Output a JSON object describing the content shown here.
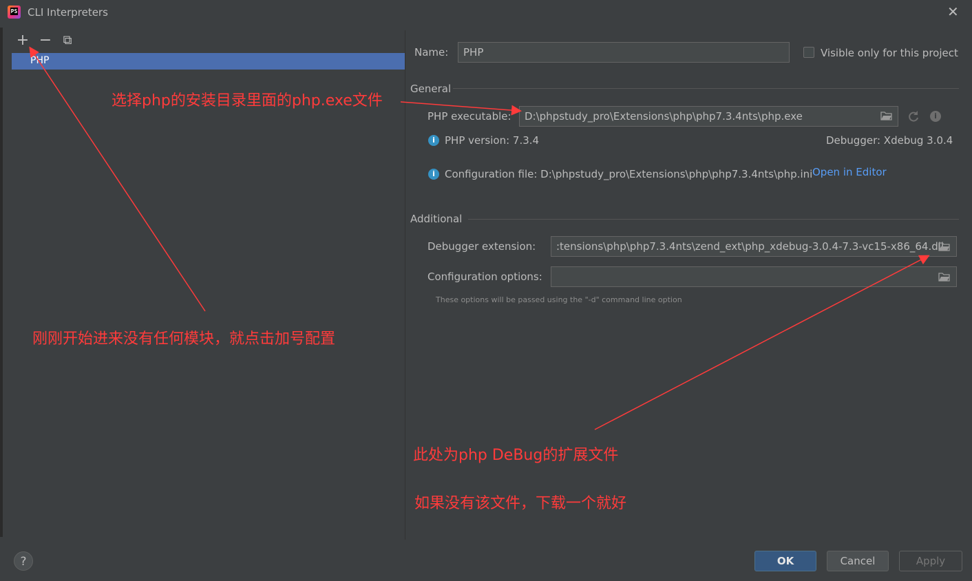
{
  "window": {
    "title": "CLI Interpreters",
    "close_glyph": "✕",
    "icon": "phpstorm-logo",
    "icon_text": "PS"
  },
  "toolbar": {
    "add_glyph": "+",
    "remove_glyph": "−",
    "copy_glyph": "⧉"
  },
  "interpreter_list": {
    "items": [
      {
        "label": "PHP",
        "selected": true
      }
    ]
  },
  "form": {
    "name_label": "Name:",
    "name_value": "PHP",
    "visible_only_label": "Visible only for this project",
    "visible_only_checked": false,
    "general": {
      "section_title": "General",
      "php_executable_label": "PHP executable:",
      "php_executable_value": "D:\\phpstudy_pro\\Extensions\\php\\php7.3.4nts\\php.exe",
      "php_version": "PHP version: 7.3.4",
      "debugger": "Debugger: Xdebug 3.0.4",
      "config_file": "Configuration file: D:\\phpstudy_pro\\Extensions\\php\\php7.3.4nts\\php.ini",
      "open_in_editor": "Open in Editor"
    },
    "additional": {
      "section_title": "Additional",
      "debugger_extension_label": "Debugger extension:",
      "debugger_extension_value": ":tensions\\php\\php7.3.4nts\\zend_ext\\php_xdebug-3.0.4-7.3-vc15-x86_64.dll",
      "configuration_options_label": "Configuration options:",
      "configuration_options_value": "",
      "hint": "These options will be passed using the \"-d\" command line option"
    }
  },
  "annotations": {
    "select_exe": "选择php的安装目录里面的php.exe文件",
    "add_module": "刚刚开始进来没有任何模块，就点击加号配置",
    "debug_ext": "此处为php DeBug的扩展文件",
    "download": "如果没有该文件，下载一个就好",
    "color": "#ff3b3b"
  },
  "buttons": {
    "ok": "OK",
    "cancel": "Cancel",
    "apply": "Apply",
    "help": "?"
  },
  "colors": {
    "background": "#3c3f41",
    "selection": "#4b6eaf",
    "link": "#589df6",
    "info": "#3592c4"
  }
}
